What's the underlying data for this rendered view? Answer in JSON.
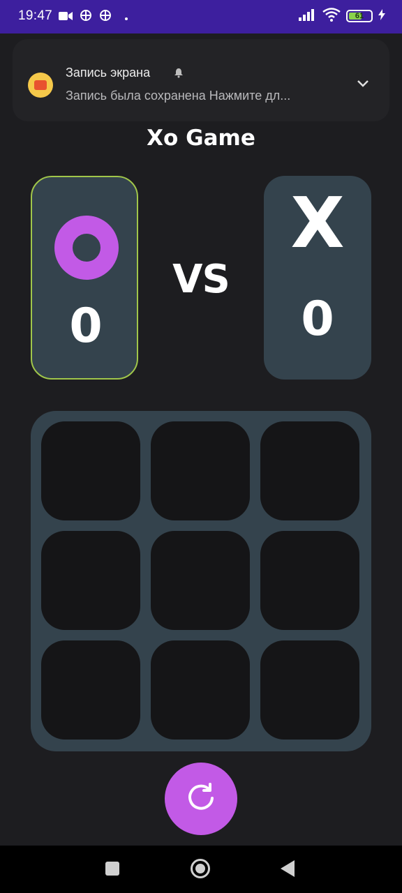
{
  "status_bar": {
    "time": "19:47",
    "battery_level": "61",
    "battery_fraction": 0.61,
    "icons": [
      "video-camera-icon",
      "vpn-icon",
      "vpn-icon",
      "dot-icon",
      "signal-icon",
      "wifi-icon",
      "battery-icon",
      "charging-icon"
    ]
  },
  "notification": {
    "title": "Запись экрана",
    "text": "Запись была сохранена Нажмите дл...",
    "icon": "screen-recorder-icon"
  },
  "game": {
    "title": "Xo Game",
    "vs_label": "VS",
    "player_o": {
      "symbol": "O",
      "score": "0",
      "active": true,
      "color": "#c25ae6"
    },
    "player_x": {
      "symbol": "X",
      "score": "0",
      "active": false
    },
    "board": [
      "",
      "",
      "",
      "",
      "",
      "",
      "",
      "",
      ""
    ],
    "reset_icon": "refresh-icon"
  },
  "colors": {
    "background": "#1d1d20",
    "panel": "#34434d",
    "cell": "#151517",
    "accent": "#c25ae6",
    "active_border": "#a0c64a",
    "status_bar": "#3d1f9e"
  },
  "nav_bar": {
    "buttons": [
      "recents-button",
      "home-button",
      "back-button"
    ]
  }
}
